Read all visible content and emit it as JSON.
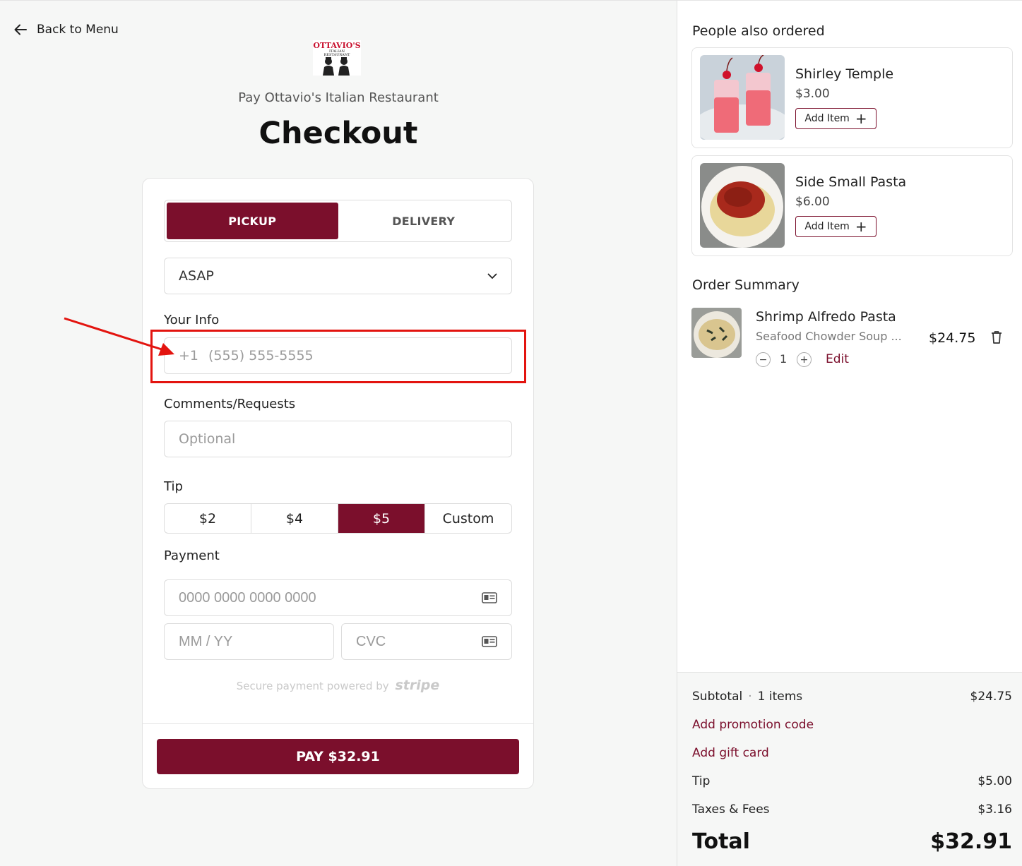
{
  "nav": {
    "back_label": "Back to Menu"
  },
  "restaurant": {
    "logo_text_1": "OTTAVIO'S",
    "logo_text_2": "ITALIAN",
    "logo_text_3": "RESTAURANT",
    "pay_to": "Pay Ottavio's Italian Restaurant"
  },
  "page": {
    "title": "Checkout"
  },
  "order_type": {
    "tabs": [
      {
        "label": "PICKUP",
        "active": true
      },
      {
        "label": "DELIVERY",
        "active": false
      }
    ]
  },
  "timing": {
    "selected": "ASAP"
  },
  "your_info": {
    "label": "Your Info",
    "country_code": "+1",
    "phone_placeholder": "(555) 555-5555"
  },
  "comments": {
    "label": "Comments/Requests",
    "placeholder": "Optional"
  },
  "tip": {
    "label": "Tip",
    "options": [
      {
        "label": "$2",
        "active": false
      },
      {
        "label": "$4",
        "active": false
      },
      {
        "label": "$5",
        "active": true
      },
      {
        "label": "Custom",
        "active": false
      }
    ]
  },
  "payment": {
    "label": "Payment",
    "card_placeholder": "0000 0000 0000 0000",
    "expiry_placeholder": "MM / YY",
    "cvc_placeholder": "CVC",
    "secure_note": "Secure payment powered by",
    "provider": "stripe",
    "pay_button": "PAY $32.91"
  },
  "upsell": {
    "title": "People also ordered",
    "items": [
      {
        "name": "Shirley Temple",
        "price": "$3.00",
        "add_label": "Add Item"
      },
      {
        "name": "Side Small Pasta",
        "price": "$6.00",
        "add_label": "Add Item"
      }
    ]
  },
  "order_summary": {
    "title": "Order Summary",
    "items": [
      {
        "name": "Shrimp Alfredo Pasta",
        "description": "Seafood Chowder Soup ...",
        "price": "$24.75",
        "quantity": "1",
        "edit_label": "Edit"
      }
    ]
  },
  "totals": {
    "subtotal_label": "Subtotal",
    "item_count": "1 items",
    "subtotal": "$24.75",
    "promo_link": "Add promotion code",
    "gift_link": "Add gift card",
    "tip_label": "Tip",
    "tip": "$5.00",
    "taxes_label": "Taxes & Fees",
    "taxes": "$3.16",
    "total_label": "Total",
    "total": "$32.91"
  },
  "colors": {
    "brand": "#7b0f2c",
    "annotation": "#e3140f",
    "background": "#f6f7f6"
  }
}
